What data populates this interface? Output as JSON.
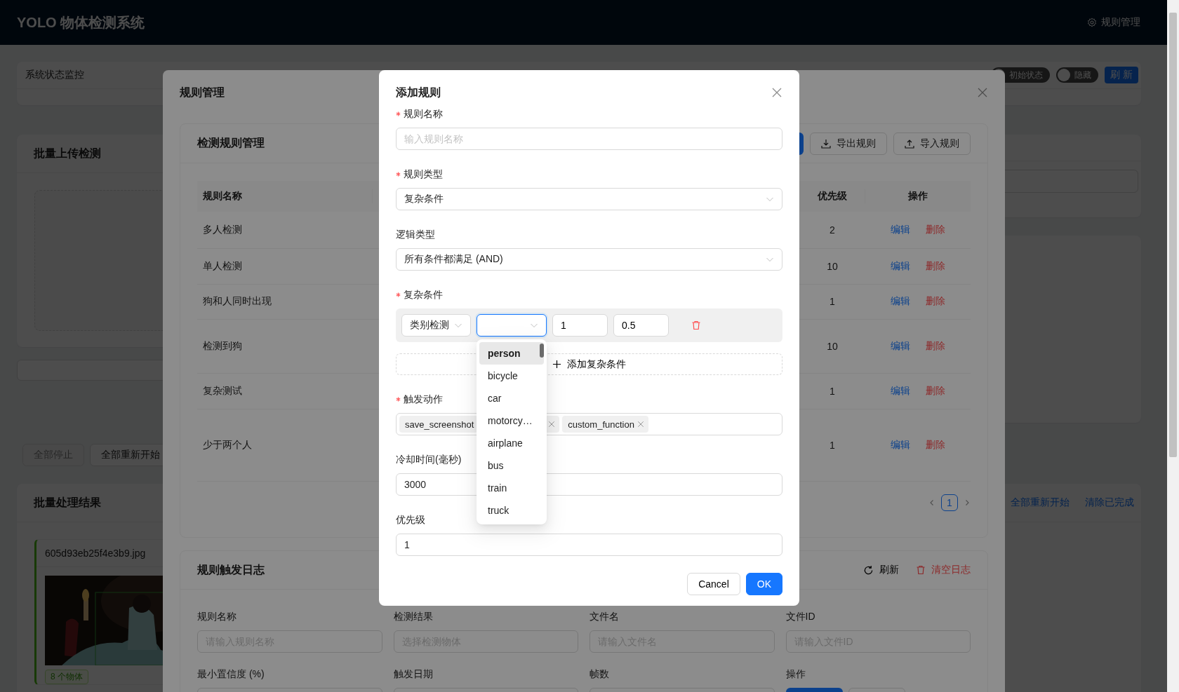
{
  "app": {
    "title": "YOLO 物体检测系统",
    "nav_link": "规则管理"
  },
  "status_card": {
    "title": "系统状态监控",
    "toggles": [
      {
        "label": "初始状态",
        "on": false
      },
      {
        "label": "隐藏",
        "on": false
      }
    ],
    "refresh_button": "刷 新"
  },
  "upload_card": {
    "title": "批量上传检测"
  },
  "batch_buttons": [
    {
      "label": "全部停止",
      "disabled": true
    },
    {
      "label": "全部重新开始",
      "disabled": false
    }
  ],
  "results_card": {
    "title": "批量处理结果",
    "links": [
      "全部重新开始",
      "清除已完成"
    ],
    "items": [
      {
        "filename": "605d93eb25f4e3b9.jpg",
        "badge": "8 个物体"
      }
    ]
  },
  "rule_manager": {
    "title": "规则管理",
    "rules_card": {
      "title": "检测规则管理",
      "buttons": [
        {
          "kind": "export",
          "label": "导出规则"
        },
        {
          "kind": "import",
          "label": "导入规则"
        }
      ],
      "columns": [
        "规则名称",
        "优先级",
        "操作"
      ],
      "rows": [
        {
          "name": "多人检测",
          "priority": "2",
          "actions": [
            "编辑",
            "删除"
          ]
        },
        {
          "name": "单人检测",
          "priority": "10",
          "actions": [
            "编辑",
            "删除"
          ]
        },
        {
          "name": "狗和人同时出现",
          "priority": "1",
          "actions": [
            "编辑",
            "删除"
          ]
        },
        {
          "name": "检测到狗",
          "priority": "10",
          "actions": [
            "编辑",
            "删除"
          ]
        },
        {
          "name": "复杂测试",
          "priority": "1",
          "actions": [
            "编辑",
            "删除"
          ]
        },
        {
          "name": "少于两个人",
          "priority": "1",
          "actions": [
            "编辑",
            "删除"
          ]
        }
      ],
      "pagination": [
        {
          "label": "1",
          "selected": true
        }
      ]
    },
    "log_card": {
      "title": "规则触发日志",
      "actions": [
        {
          "kind": "refresh",
          "label": "刷新"
        },
        {
          "kind": "clear",
          "label": "清空日志"
        }
      ],
      "filters": [
        {
          "label": "规则名称",
          "placeholder": "请输入规则名称"
        },
        {
          "label": "检测结果",
          "placeholder": "选择检测物体"
        },
        {
          "label": "文件名",
          "placeholder": "请输入文件名"
        },
        {
          "label": "文件ID",
          "placeholder": "请输入文件ID"
        }
      ],
      "filters_row2": [
        "最小置信度 (%)",
        "触发日期",
        "帧数",
        "操作"
      ]
    }
  },
  "add_rule_dialog": {
    "title": "添加规则",
    "fields_top": [
      {
        "label": "规则名称",
        "required": true,
        "kind": "input",
        "placeholder": "输入规则名称"
      },
      {
        "label": "规则类型",
        "required": true,
        "kind": "select",
        "value": "复杂条件"
      },
      {
        "label": "逻辑类型",
        "required": false,
        "kind": "select",
        "value": "所有条件都满足 (AND)"
      }
    ],
    "conditions": {
      "label": "复杂条件",
      "required": true,
      "row": [
        {
          "kind": "select",
          "value": "类别检测",
          "focused": false
        },
        {
          "kind": "select",
          "focused": true
        },
        {
          "kind": "input",
          "value": "1",
          "focused": false
        },
        {
          "kind": "input",
          "value": "0.5",
          "focused": false
        }
      ],
      "add_button": "添加复杂条件"
    },
    "class_options": [
      {
        "label": "person",
        "selected": true
      },
      {
        "label": "bicycle",
        "selected": false
      },
      {
        "label": "car",
        "selected": false
      },
      {
        "label": "motorcy…",
        "selected": false
      },
      {
        "label": "airplane",
        "selected": false
      },
      {
        "label": "bus",
        "selected": false
      },
      {
        "label": "train",
        "selected": false
      },
      {
        "label": "truck",
        "selected": false
      }
    ],
    "actions_field": {
      "label": "触发动作",
      "required": true,
      "tags": [
        {
          "label": "save_screenshot",
          "closable": false
        },
        {
          "closable": true
        },
        {
          "label": "custom_function",
          "closable": true
        }
      ]
    },
    "fields_bottom": [
      {
        "label": "冷却时间(毫秒)",
        "required": false,
        "kind": "input",
        "value": "3000"
      },
      {
        "label": "优先级",
        "required": false,
        "kind": "input",
        "value": "1"
      }
    ],
    "buttons": [
      {
        "label": "Cancel",
        "kind": "default"
      },
      {
        "label": "OK",
        "kind": "primary"
      }
    ]
  }
}
